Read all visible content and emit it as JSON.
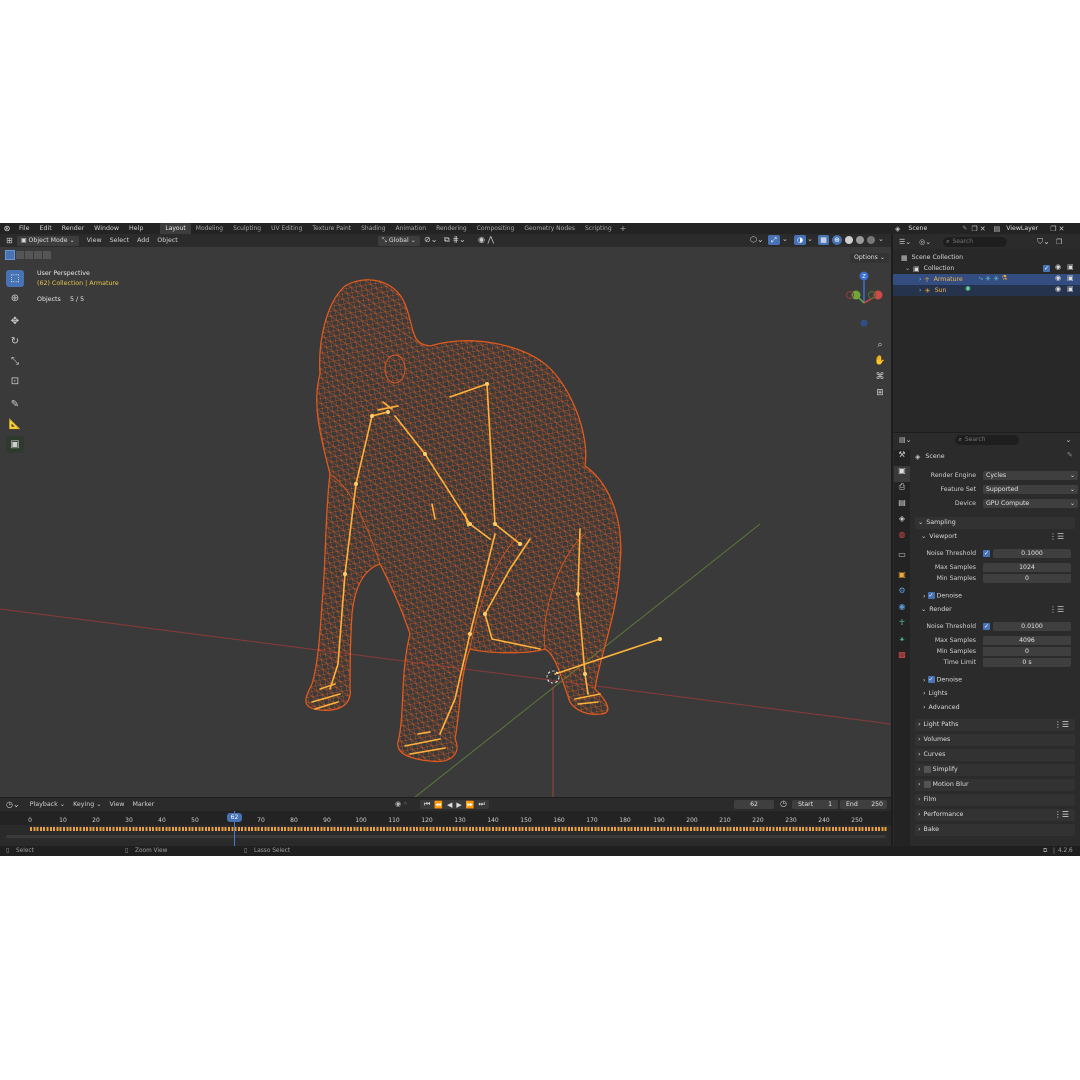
{
  "menu": [
    "File",
    "Edit",
    "Render",
    "Window",
    "Help"
  ],
  "workspaces": [
    {
      "label": "Layout",
      "active": true
    },
    {
      "label": "Modeling"
    },
    {
      "label": "Sculpting"
    },
    {
      "label": "UV Editing"
    },
    {
      "label": "Texture Paint"
    },
    {
      "label": "Shading"
    },
    {
      "label": "Animation"
    },
    {
      "label": "Rendering"
    },
    {
      "label": "Compositing"
    },
    {
      "label": "Geometry Nodes"
    },
    {
      "label": "Scripting"
    }
  ],
  "scene_name": "Scene",
  "view_layer": "ViewLayer",
  "viewport": {
    "mode": "Object Mode",
    "menus": [
      "View",
      "Select",
      "Add",
      "Object"
    ],
    "transform_orientation": "Global",
    "options": "Options",
    "perspective": "User Perspective",
    "collection_info": "(62) Collection | Armature",
    "objects_label": "Objects",
    "objects_count": "5 / 5",
    "gizmo": {
      "x": "X",
      "y": "Y",
      "z": "Z"
    }
  },
  "outliner": {
    "search_placeholder": "Search",
    "scene_collection": "Scene Collection",
    "collection": "Collection",
    "items": [
      "Armature",
      "Sun"
    ]
  },
  "properties": {
    "search_placeholder": "Search",
    "breadcrumb": "Scene",
    "render_engine_label": "Render Engine",
    "render_engine": "Cycles",
    "feature_set_label": "Feature Set",
    "feature_set": "Supported",
    "device_label": "Device",
    "device": "GPU Compute",
    "sampling": "Sampling",
    "viewport_panel": "Viewport",
    "noise_threshold_label": "Noise Threshold",
    "viewport_noise_threshold": "0.1000",
    "max_samples_label": "Max Samples",
    "viewport_max_samples": "1024",
    "min_samples_label": "Min Samples",
    "viewport_min_samples": "0",
    "denoise": "Denoise",
    "render_panel": "Render",
    "render_noise_threshold": "0.0100",
    "render_max_samples": "4096",
    "render_min_samples": "0",
    "time_limit_label": "Time Limit",
    "time_limit": "0 s",
    "lights": "Lights",
    "advanced": "Advanced",
    "sections": [
      "Light Paths",
      "Volumes",
      "Curves",
      "Simplify",
      "Motion Blur",
      "Film",
      "Performance",
      "Bake"
    ]
  },
  "timeline": {
    "menus": [
      "Playback",
      "Keying",
      "View",
      "Marker"
    ],
    "current_frame": "62",
    "start_label": "Start",
    "start": "1",
    "end_label": "End",
    "end": "250",
    "ticks": [
      "0",
      "10",
      "20",
      "30",
      "40",
      "50",
      "70",
      "80",
      "90",
      "100",
      "110",
      "120",
      "130",
      "140",
      "150",
      "160",
      "170",
      "180",
      "190",
      "200",
      "210",
      "220",
      "230",
      "240",
      "250"
    ],
    "playhead_label": "62"
  },
  "status": {
    "select": "Select",
    "zoom_view": "Zoom View",
    "lasso_select": "Lasso Select",
    "version": "4.2.6"
  },
  "colors": {
    "accent": "#4772b3",
    "wire": "#e05a1e",
    "bone": "#ffb23a",
    "selected_row": "#334d80"
  }
}
